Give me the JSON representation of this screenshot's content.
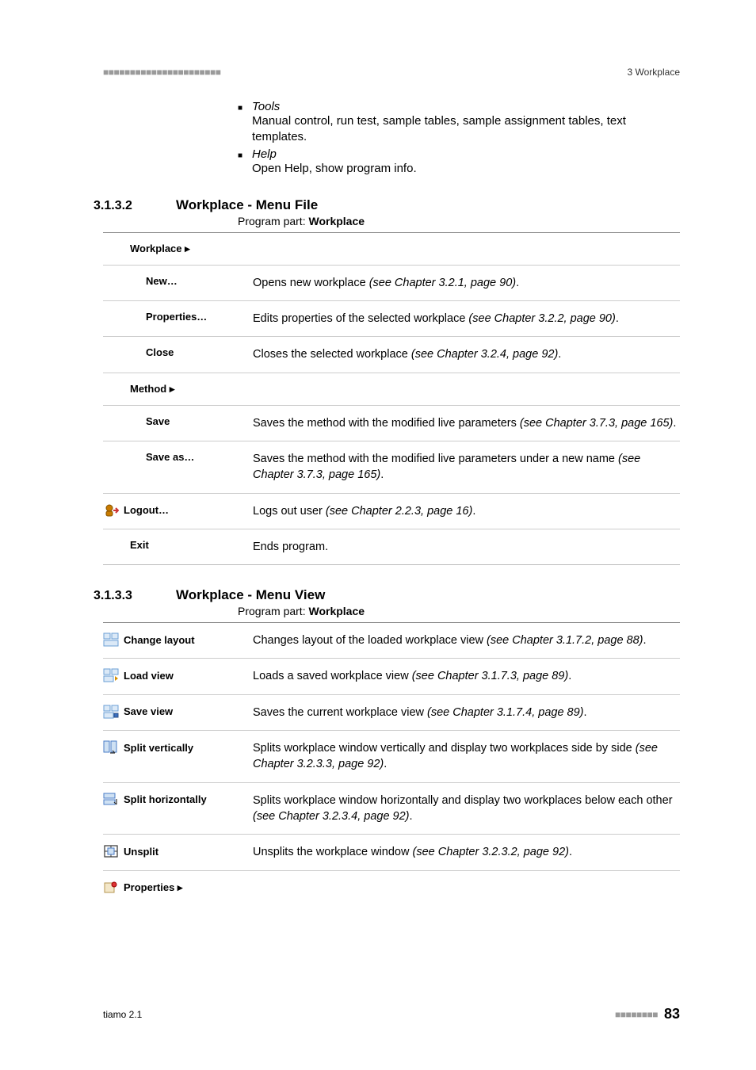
{
  "header": {
    "left_deco": "■■■■■■■■■■■■■■■■■■■■■■",
    "right": "3 Workplace"
  },
  "intro": [
    {
      "title": "Tools",
      "desc": "Manual control, run test, sample tables, sample assignment tables, text templates."
    },
    {
      "title": "Help",
      "desc": "Open Help, show program info."
    }
  ],
  "sect_a": {
    "num": "3.1.3.2",
    "title": "Workplace - Menu File",
    "program_label": "Program part: ",
    "program_value": "Workplace",
    "rows": [
      {
        "label": "Workplace ▸",
        "indent": 1,
        "desc": "",
        "ref": ""
      },
      {
        "label": "New…",
        "indent": 2,
        "desc": "Opens new workplace ",
        "ref": "(see Chapter 3.2.1, page 90)",
        "tail": "."
      },
      {
        "label": "Properties…",
        "indent": 2,
        "desc": "Edits properties of the selected workplace ",
        "ref": "(see Chapter 3.2.2, page 90)",
        "tail": "."
      },
      {
        "label": "Close",
        "indent": 2,
        "desc": "Closes the selected workplace ",
        "ref": "(see Chapter 3.2.4, page 92)",
        "tail": "."
      },
      {
        "label": "Method ▸",
        "indent": 1,
        "desc": "",
        "ref": ""
      },
      {
        "label": "Save",
        "indent": 2,
        "desc": "Saves the method with the modified live parameters ",
        "ref": "(see Chapter 3.7.3, page 165)",
        "tail": "."
      },
      {
        "label": "Save as…",
        "indent": 2,
        "desc": "Saves the method with the modified live parameters under a new name ",
        "ref": "(see Chapter 3.7.3, page 165)",
        "tail": "."
      },
      {
        "label": "Logout…",
        "indent": 0,
        "icon": "logout",
        "desc": "Logs out user ",
        "ref": "(see Chapter 2.2.3, page 16)",
        "tail": "."
      },
      {
        "label": "Exit",
        "indent": 1,
        "desc": "Ends program.",
        "ref": ""
      }
    ]
  },
  "sect_b": {
    "num": "3.1.3.3",
    "title": "Workplace - Menu View",
    "program_label": "Program part: ",
    "program_value": "Workplace",
    "rows": [
      {
        "label": "Change layout",
        "icon": "change-layout",
        "desc": "Changes layout of the loaded workplace view ",
        "ref": "(see Chapter 3.1.7.2, page 88)",
        "tail": "."
      },
      {
        "label": "Load view",
        "icon": "load-view",
        "desc": "Loads a saved workplace view ",
        "ref": "(see Chapter 3.1.7.3, page 89)",
        "tail": "."
      },
      {
        "label": "Save view",
        "icon": "save-view",
        "desc": "Saves the current workplace view ",
        "ref": "(see Chapter 3.1.7.4, page 89)",
        "tail": "."
      },
      {
        "label": "Split vertically",
        "icon": "split-v",
        "desc": "Splits workplace window vertically and display two workplaces side by side ",
        "ref": "(see Chapter 3.2.3.3, page 92)",
        "tail": "."
      },
      {
        "label": "Split horizontally",
        "icon": "split-h",
        "desc": "Splits workplace window horizontally and display two workplaces below each other ",
        "ref": "(see Chapter 3.2.3.4, page 92)",
        "tail": "."
      },
      {
        "label": "Unsplit",
        "icon": "unsplit",
        "desc": "Unsplits the workplace window ",
        "ref": "(see Chapter 3.2.3.2, page 92)",
        "tail": "."
      },
      {
        "label": "Properties ▸",
        "icon": "properties",
        "desc": "",
        "ref": ""
      }
    ]
  },
  "footer": {
    "left": "tiamo 2.1",
    "dots": "■■■■■■■■",
    "page": "83"
  }
}
